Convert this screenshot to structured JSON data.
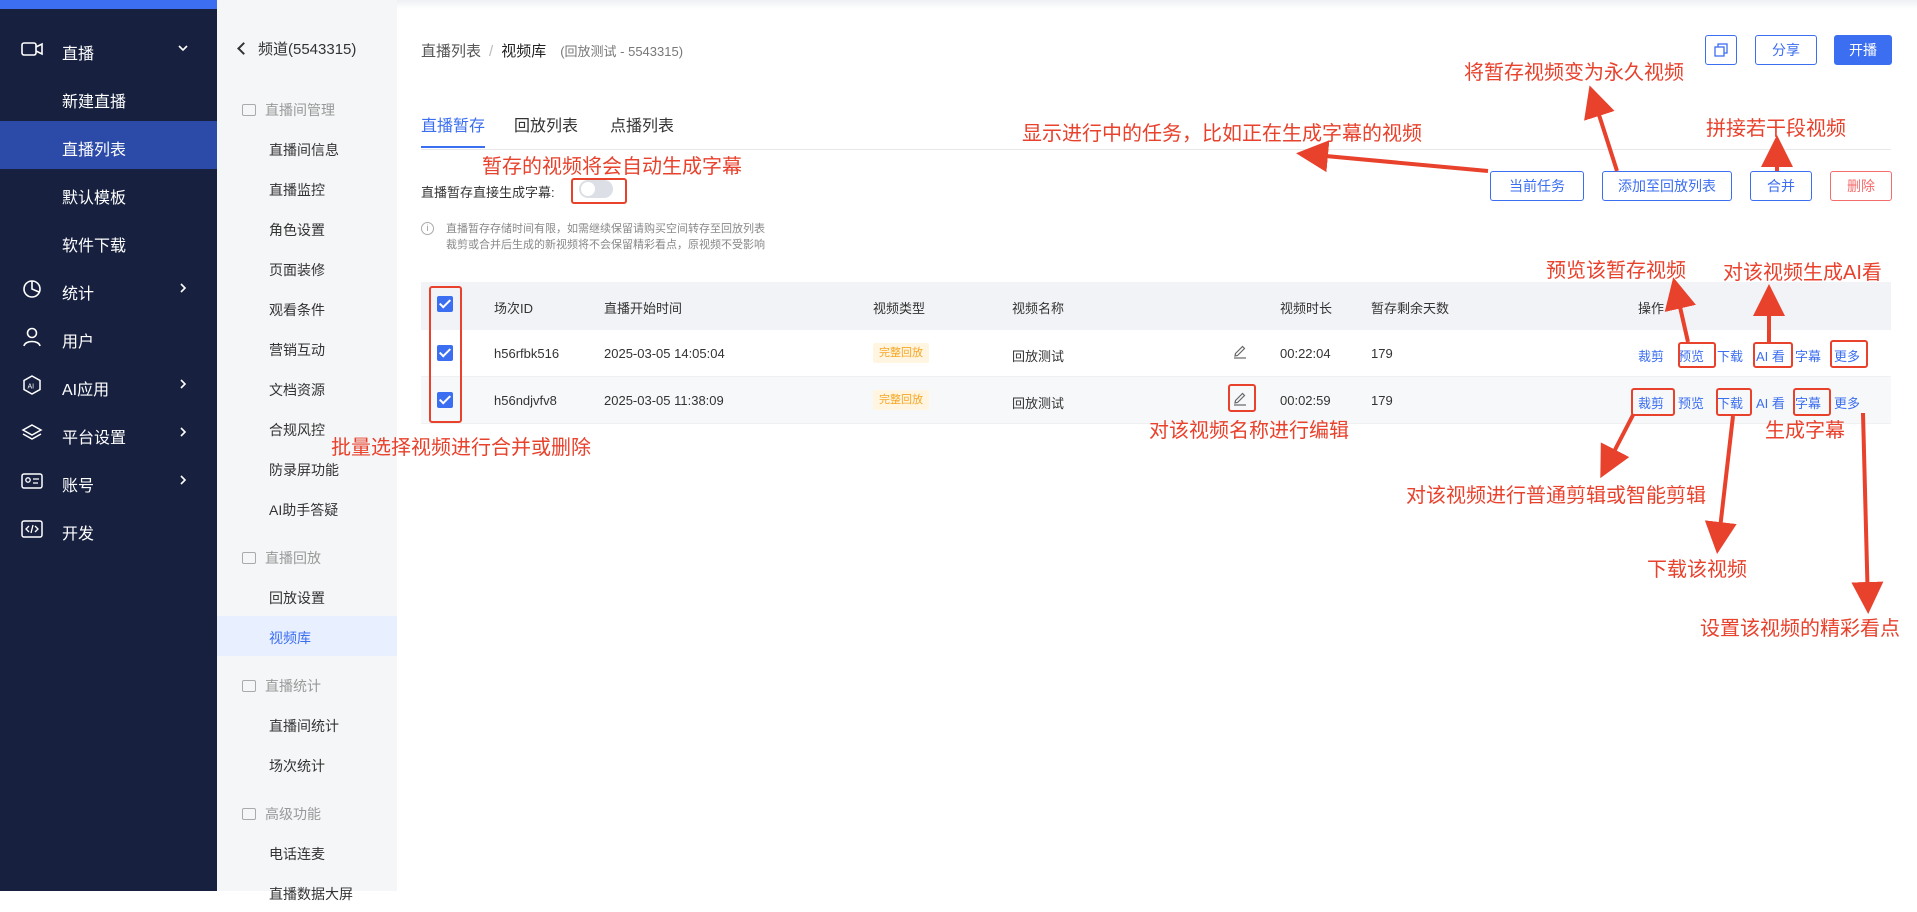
{
  "colors": {
    "nav_bg": "#17213f",
    "accent": "#3b6ef0",
    "annotation": "#e8412c",
    "danger": "#f56c6c"
  },
  "nav": {
    "items": [
      {
        "label": "直播",
        "icon": "camera-icon",
        "expanded": true
      },
      {
        "label": "统计",
        "icon": "chart-pie-icon"
      },
      {
        "label": "用户",
        "icon": "user-icon"
      },
      {
        "label": "AI应用",
        "icon": "ai-hex-icon"
      },
      {
        "label": "平台设置",
        "icon": "layers-icon"
      },
      {
        "label": "账号",
        "icon": "id-card-icon"
      },
      {
        "label": "开发",
        "icon": "code-icon"
      }
    ],
    "sub_items": [
      "新建直播",
      "直播列表",
      "默认模板",
      "软件下载"
    ]
  },
  "channel": {
    "back_label": "频道(5543315)",
    "groups": [
      {
        "title": "直播间管理",
        "items": [
          "直播间信息",
          "直播监控",
          "角色设置",
          "页面装修",
          "观看条件",
          "营销互动",
          "文档资源",
          "合规风控",
          "防录屏功能",
          "AI助手答疑"
        ]
      },
      {
        "title": "直播回放",
        "items": [
          "回放设置",
          "视频库"
        ]
      },
      {
        "title": "直播统计",
        "items": [
          "直播间统计",
          "场次统计"
        ]
      },
      {
        "title": "高级功能",
        "items": [
          "电话连麦",
          "直播数据大屏"
        ]
      }
    ]
  },
  "breadcrumb": {
    "root": "直播列表",
    "separator": "/",
    "current": "视频库",
    "sub": "(回放测试 - 5543315)"
  },
  "header_buttons": {
    "copy_icon": "copy-icon",
    "share": "分享",
    "start": "开播"
  },
  "tabs": [
    "直播暂存",
    "回放列表",
    "点播列表"
  ],
  "toggle": {
    "label": "直播暂存直接生成字幕:",
    "on": false
  },
  "info": {
    "line1": "直播暂存存储时间有限，如需继续保留请购买空间转存至回放列表",
    "line2": "裁剪或合并后生成的新视频将不会保留精彩看点，原视频不受影响"
  },
  "actions": {
    "current_task": "当前任务",
    "add_to_playback": "添加至回放列表",
    "merge": "合并",
    "delete": "删除"
  },
  "table": {
    "headers": [
      "场次ID",
      "直播开始时间",
      "视频类型",
      "视频名称",
      "视频时长",
      "暂存剩余天数",
      "操作"
    ],
    "rows": [
      {
        "id": "h56rfbk516",
        "start": "2025-03-05 14:05:04",
        "type": "完整回放",
        "name": "回放测试",
        "duration": "00:22:04",
        "days": "179"
      },
      {
        "id": "h56ndjvfv8",
        "start": "2025-03-05 11:38:09",
        "type": "完整回放",
        "name": "回放测试",
        "duration": "00:02:59",
        "days": "179"
      }
    ],
    "ops": [
      "裁剪",
      "预览",
      "下载",
      "AI 看",
      "字幕",
      "更多"
    ]
  },
  "annotations": {
    "auto_subtitle": "暂存的视频将会自动生成字幕",
    "batch": "批量选择视频进行合并或删除",
    "current_task": "显示进行中的任务，比如正在生成字幕的视频",
    "permanent": "将暂存视频变为永久视频",
    "merge": "拼接若干段视频",
    "preview": "预览该暂存视频",
    "ai": "对该视频生成AI看",
    "rename": "对该视频名称进行编辑",
    "subtitle": "生成字幕",
    "clip": "对该视频进行普通剪辑或智能剪辑",
    "download": "下载该视频",
    "highlight": "设置该视频的精彩看点"
  }
}
